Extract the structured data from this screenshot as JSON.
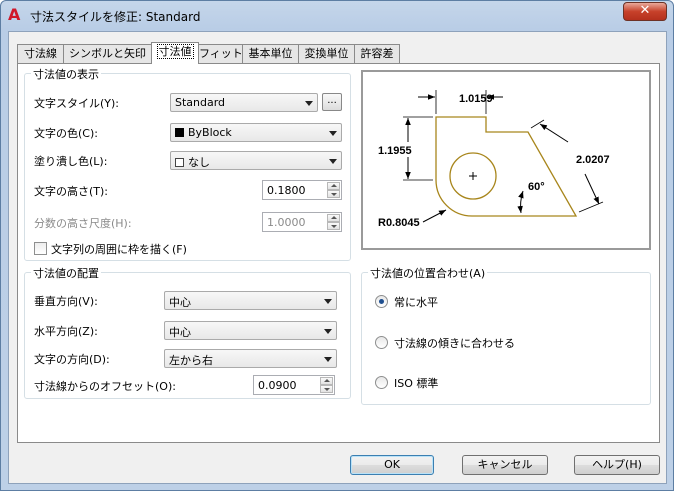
{
  "window": {
    "title": "寸法スタイルを修正: Standard",
    "close_label": "✕"
  },
  "tabs": [
    "寸法線",
    "シンボルと矢印",
    "寸法値",
    "フィット",
    "基本単位",
    "変換単位",
    "許容差"
  ],
  "text_appearance": {
    "title": "寸法値の表示",
    "style_label": "文字スタイル(Y):",
    "style_value": "Standard",
    "ellipsis": "...",
    "color_label": "文字の色(C):",
    "color_value": "ByBlock",
    "fill_label": "塗り潰し色(L):",
    "fill_value": "なし",
    "height_label": "文字の高さ(T):",
    "height_value": "0.1800",
    "fraction_label": "分数の高さ尺度(H):",
    "fraction_value": "1.0000",
    "frame_label": "文字列の周囲に枠を描く(F)"
  },
  "text_placement": {
    "title": "寸法値の配置",
    "vertical_label": "垂直方向(V):",
    "vertical_value": "中心",
    "horizontal_label": "水平方向(Z):",
    "horizontal_value": "中心",
    "direction_label": "文字の方向(D):",
    "direction_value": "左から右",
    "offset_label": "寸法線からのオフセット(O):",
    "offset_value": "0.0900"
  },
  "text_alignment": {
    "title": "寸法値の位置合わせ(A)",
    "options": [
      "常に水平",
      "寸法線の傾きに合わせる",
      "ISO 標準"
    ],
    "selected": 0
  },
  "preview": {
    "dim_top": "1.0159",
    "dim_left": "1.1955",
    "dim_right": "2.0207",
    "angle": "60°",
    "radius": "R0.8045",
    "outline_color": "#a8861c"
  },
  "buttons": {
    "ok": "OK",
    "cancel": "キャンセル",
    "help": "ヘルプ(H)"
  }
}
